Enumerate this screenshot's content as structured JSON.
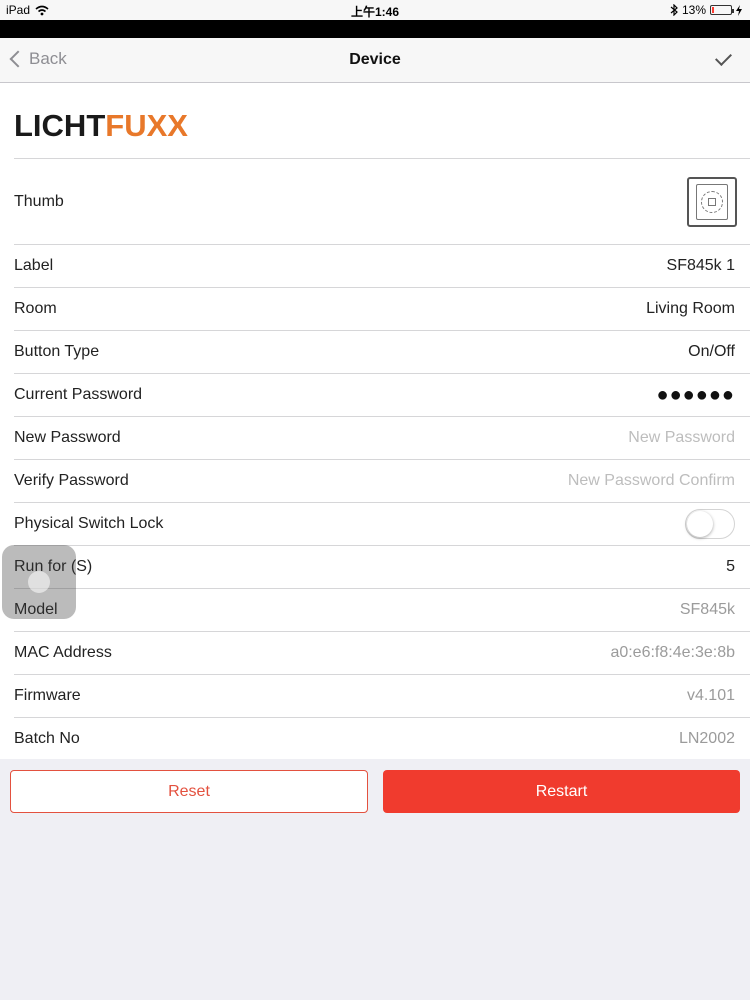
{
  "status_bar": {
    "device": "iPad",
    "time": "上午1:46",
    "battery": "13%",
    "battery_level": 0.13
  },
  "nav": {
    "back_label": "Back",
    "title": "Device"
  },
  "logo": {
    "part1": "LICHT",
    "part2": "FUXX"
  },
  "fields": {
    "thumb": {
      "label": "Thumb"
    },
    "label": {
      "label": "Label",
      "value": "SF845k 1"
    },
    "room": {
      "label": "Room",
      "value": "Living Room"
    },
    "button_type": {
      "label": "Button Type",
      "value": "On/Off"
    },
    "current_password": {
      "label": "Current Password",
      "value": "●●●●●●"
    },
    "new_password": {
      "label": "New Password",
      "placeholder": "New Password"
    },
    "verify_password": {
      "label": "Verify Password",
      "placeholder": "New Password Confirm"
    },
    "physical_switch_lock": {
      "label": "Physical Switch Lock",
      "enabled": false
    },
    "run_for": {
      "label": "Run for (S)",
      "value": "5"
    },
    "model": {
      "label": "Model",
      "value": "SF845k"
    },
    "mac_address": {
      "label": "MAC Address",
      "value": "a0:e6:f8:4e:3e:8b"
    },
    "firmware": {
      "label": "Firmware",
      "value": "v4.101"
    },
    "batch_no": {
      "label": "Batch No",
      "value": "LN2002"
    }
  },
  "buttons": {
    "reset": "Reset",
    "restart": "Restart"
  },
  "colors": {
    "accent_red": "#f03b2e",
    "logo_orange": "#e8782a"
  },
  "icons": {
    "wifi": "wifi-icon",
    "bluetooth": "bluetooth-icon",
    "back": "chevron-left-icon",
    "done": "checkmark-icon",
    "thumb": "device-thumb-icon"
  }
}
